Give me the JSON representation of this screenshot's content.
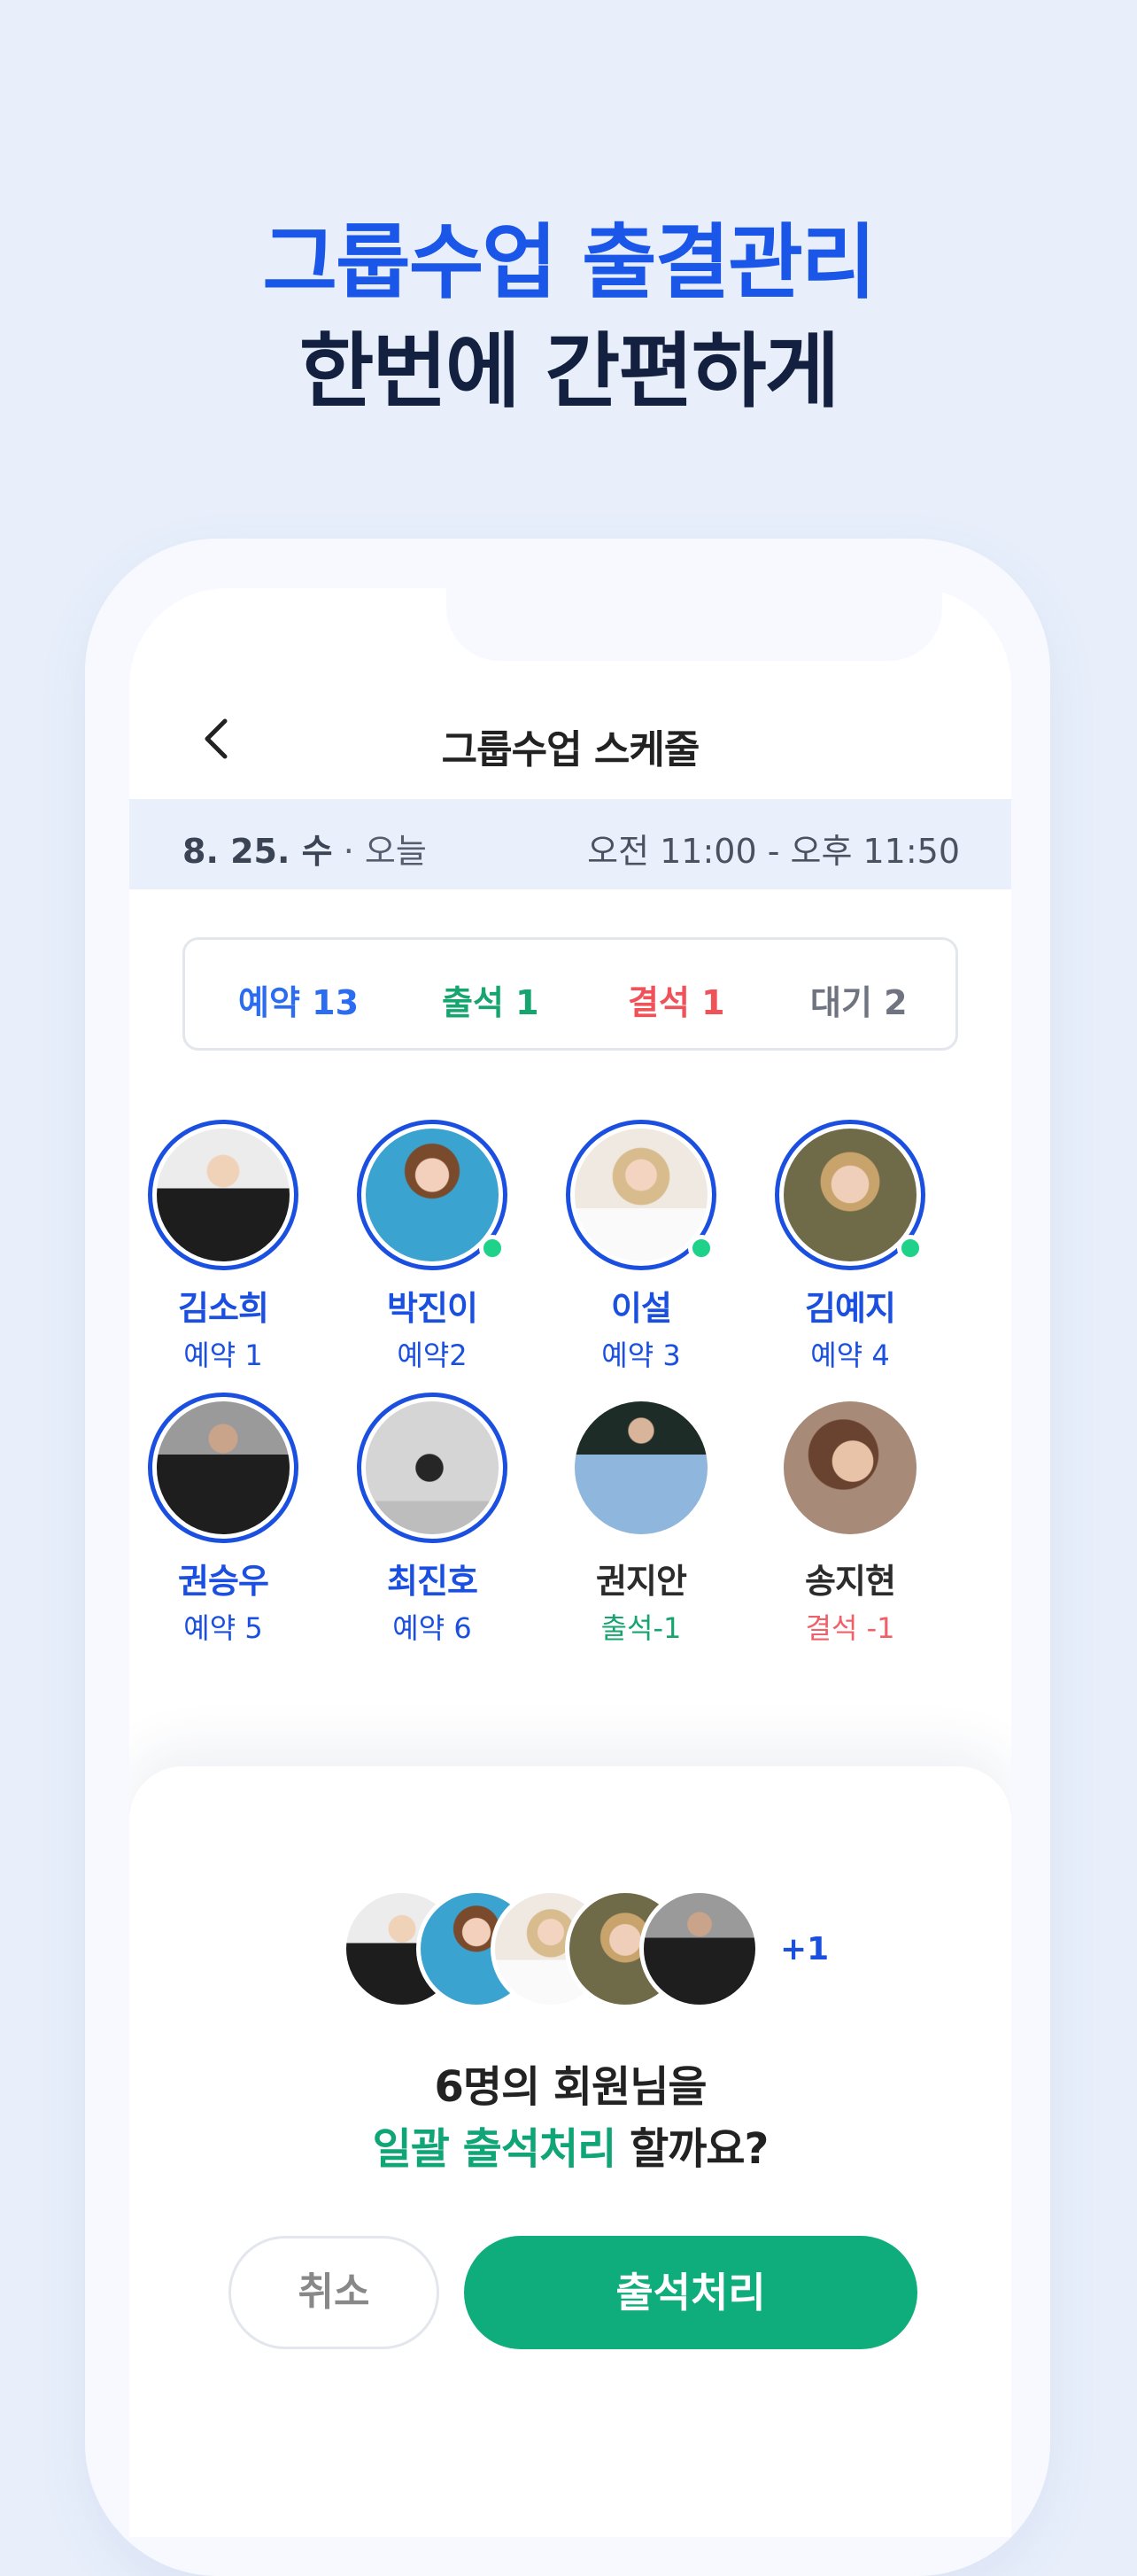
{
  "headline": {
    "line1": "그룹수업 출결관리",
    "line2": "한번에 간편하게"
  },
  "nav": {
    "title": "그룹수업 스케줄"
  },
  "date_bar": {
    "date": "8. 25. 수",
    "separator": " · ",
    "today": "오늘",
    "time": "오전 11:00 - 오후 11:50"
  },
  "stats": {
    "reserved": "예약 13",
    "attended": "출석 1",
    "absent": "결석 1",
    "waiting": "대기 2"
  },
  "members": [
    {
      "name": "김소희",
      "status": "예약 1"
    },
    {
      "name": "박진이",
      "status": "예약2"
    },
    {
      "name": "이설",
      "status": "예약 3"
    },
    {
      "name": "김예지",
      "status": "예약 4"
    },
    {
      "name": "권승우",
      "status": "예약 5"
    },
    {
      "name": "최진호",
      "status": "예약 6"
    },
    {
      "name": "권지안",
      "status": "출석-1"
    },
    {
      "name": "송지현",
      "status": "결석 -1"
    }
  ],
  "sheet": {
    "extra_count": "+1",
    "question_line1": "6명의 회원님을",
    "question_highlight": "일괄 출석처리",
    "question_rest": " 할까요?",
    "cancel_label": "취소",
    "confirm_label": "출석처리"
  },
  "colors": {
    "accent_blue": "#1a4fe0",
    "green": "#0fad7c",
    "red": "#f06068"
  }
}
